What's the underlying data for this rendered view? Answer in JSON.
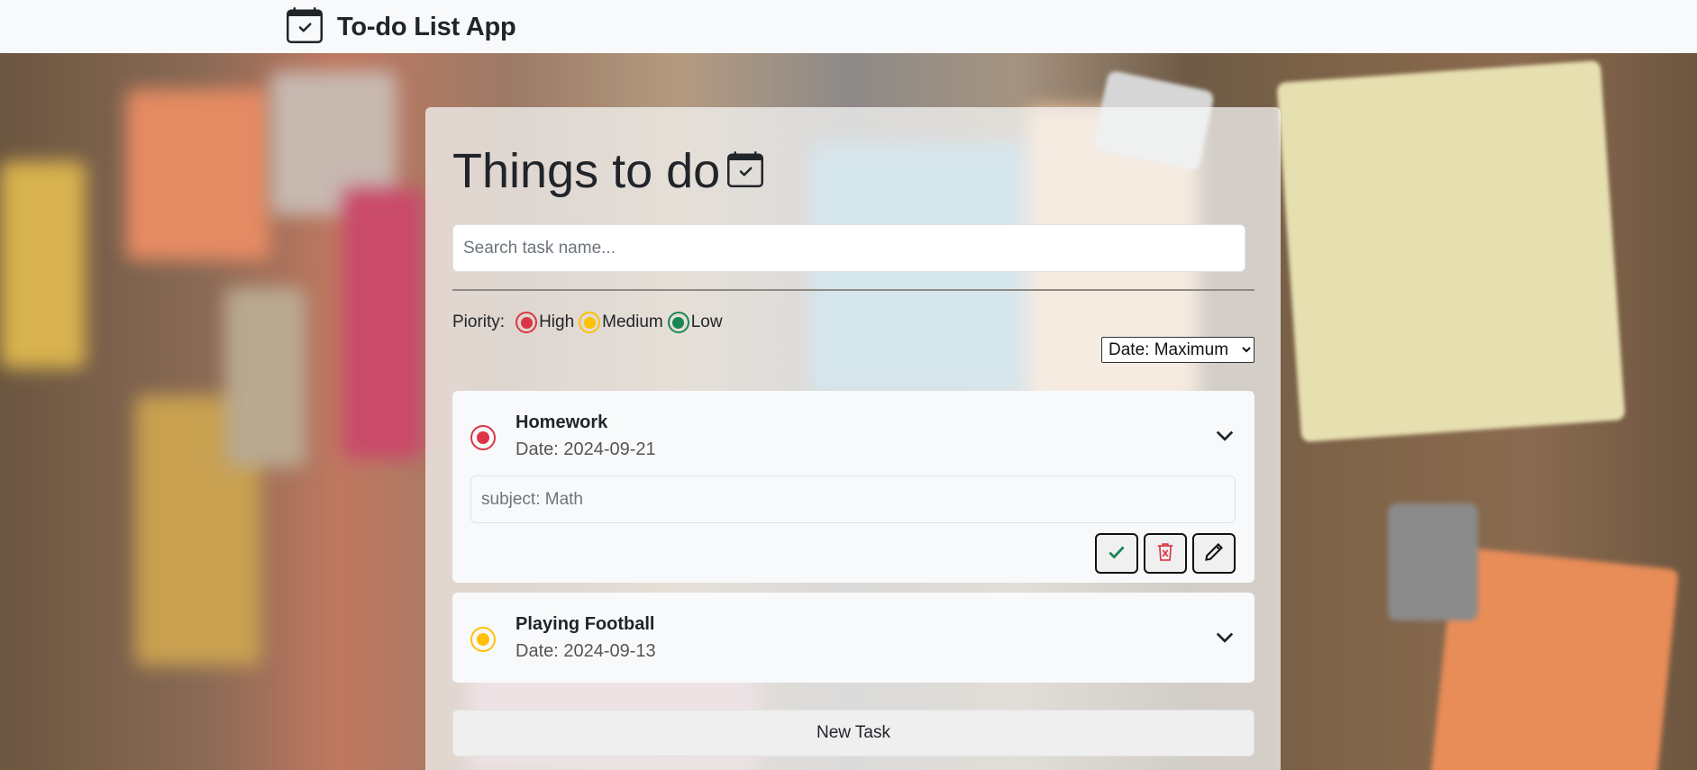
{
  "navbar": {
    "brand_text": "To-do List App",
    "brand_icon": "calendar-check-icon"
  },
  "card": {
    "title": "Things to do",
    "title_icon": "calendar-check-icon",
    "search": {
      "placeholder": "Search task name...",
      "value": ""
    },
    "priority_legend": {
      "label": "Piority:",
      "items": [
        {
          "label": "High",
          "color": "#dc3545"
        },
        {
          "label": "Medium",
          "color": "#ffc107"
        },
        {
          "label": "Low",
          "color": "#198754"
        }
      ]
    },
    "sort": {
      "selected": "Date: Maximum",
      "options": [
        "Date: Maximum"
      ]
    },
    "tasks": [
      {
        "name": "Homework",
        "date": "Date: 2024-09-21",
        "priority": "High",
        "expanded": true,
        "description": "subject: Math"
      },
      {
        "name": "Playing Football",
        "date": "Date: 2024-09-13",
        "priority": "Medium",
        "expanded": false
      }
    ],
    "new_task_label": "New Task"
  },
  "colors": {
    "high": "#dc3545",
    "medium": "#ffc107",
    "low": "#198754",
    "navbar_bg": "#f8f9fa"
  }
}
